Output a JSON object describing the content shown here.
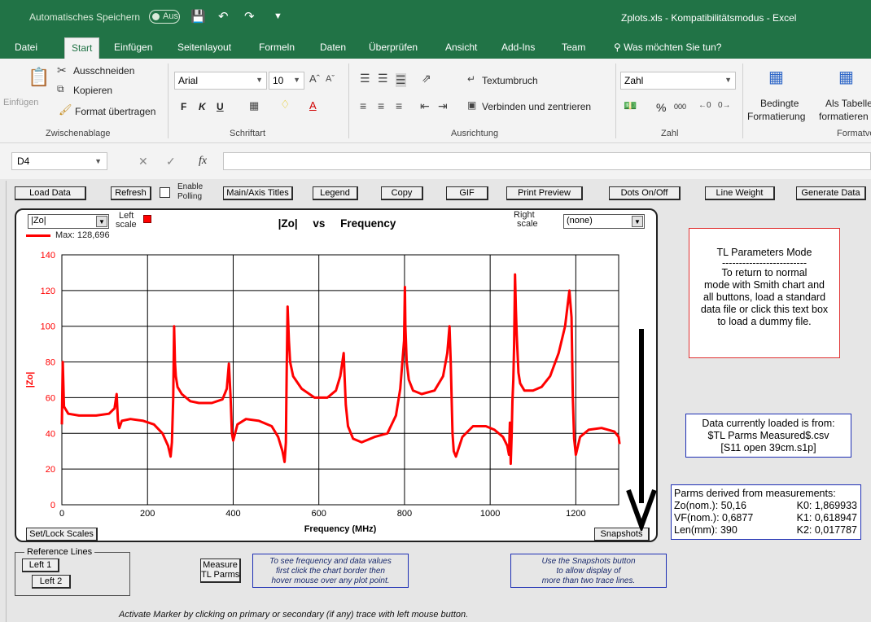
{
  "titlebar": {
    "autosave_label": "Automatisches Speichern",
    "autosave_state": "Aus",
    "window_title": "Zplots.xls  -  Kompatibilitätsmodus  -  Excel"
  },
  "tabs": [
    "Datei",
    "Start",
    "Einfügen",
    "Seitenlayout",
    "Formeln",
    "Daten",
    "Überprüfen",
    "Ansicht",
    "Add-Ins",
    "Team"
  ],
  "search_placeholder": "Was möchten Sie tun?",
  "ribbon": {
    "clipboard": {
      "paste": "Einfügen",
      "cut": "Ausschneiden",
      "copy": "Kopieren",
      "format_painter": "Format übertragen",
      "group": "Zwischenablage"
    },
    "font": {
      "font_name": "Arial",
      "font_size": "10",
      "bold": "F",
      "italic": "K",
      "underline": "U",
      "group": "Schriftart"
    },
    "alignment": {
      "wrap": "Textumbruch",
      "merge": "Verbinden und zentrieren",
      "group": "Ausrichtung"
    },
    "number": {
      "format": "Zahl",
      "percent": "%",
      "thousands": "000",
      "group": "Zahl"
    },
    "styles": {
      "conditional_1": "Bedingte",
      "conditional_2": "Formatierung",
      "table_1": "Als Tabelle",
      "table_2": "formatieren",
      "group": "Formatvo"
    }
  },
  "formula_bar": {
    "cell_ref": "D4",
    "fx": "fx",
    "value": ""
  },
  "toolbar_buttons": {
    "load_data": "Load Data",
    "refresh": "Refresh",
    "enable_polling_1": "Enable",
    "enable_polling_2": "Polling",
    "titles": "Main/Axis Titles",
    "legend": "Legend",
    "copy": "Copy",
    "gif": "GIF",
    "print_preview": "Print Preview",
    "dots": "Dots On/Off",
    "line_weight": "Line Weight",
    "generate": "Generate Data"
  },
  "chart_panel": {
    "left_select": "|Zo|",
    "left_scale_1": "Left",
    "left_scale_2": "scale",
    "right_scale_1": "Right",
    "right_scale_2": "scale",
    "right_select": "(none)",
    "legend_text": "Max: 128,696",
    "set_lock": "Set/Lock Scales",
    "snapshots": "Snapshots"
  },
  "chart_data": {
    "type": "line",
    "title": "|Zo|     vs     Frequency",
    "xlabel": "Frequency (MHz)",
    "ylabel": "|Zo|",
    "xlim": [
      0,
      1300
    ],
    "ylim": [
      0,
      140
    ],
    "xticks": [
      0,
      200,
      400,
      600,
      800,
      1000,
      1200
    ],
    "yticks": [
      0,
      20,
      40,
      60,
      80,
      100,
      120,
      140
    ],
    "grid": true,
    "series": [
      {
        "color": "#ff0000",
        "x": [
          0,
          2,
          5,
          15,
          40,
          80,
          110,
          123,
          128,
          131,
          134,
          140,
          160,
          190,
          215,
          235,
          248,
          254,
          257,
          260,
          262,
          264,
          266,
          270,
          280,
          300,
          320,
          350,
          375,
          385,
          390,
          394,
          397,
          400,
          410,
          430,
          460,
          490,
          505,
          515,
          520,
          523,
          525,
          527,
          530,
          533,
          540,
          560,
          590,
          620,
          640,
          650,
          655,
          658,
          660,
          663,
          668,
          680,
          700,
          730,
          760,
          780,
          790,
          795,
          799,
          801,
          802,
          805,
          810,
          820,
          840,
          870,
          890,
          900,
          905,
          908,
          912,
          915,
          920,
          935,
          960,
          990,
          1010,
          1030,
          1040,
          1044,
          1046,
          1048,
          1050,
          1052,
          1054,
          1056,
          1058,
          1060,
          1062,
          1064,
          1066,
          1070,
          1080,
          1100,
          1120,
          1140,
          1160,
          1175,
          1185,
          1190,
          1193,
          1196,
          1200,
          1210,
          1230,
          1260,
          1290,
          1300,
          1302
        ],
        "values": [
          45,
          80,
          55,
          51,
          50,
          50,
          51,
          54,
          62,
          47,
          43,
          47,
          48,
          47,
          45,
          40,
          33,
          27,
          35,
          60,
          100,
          80,
          72,
          66,
          62,
          58,
          57,
          57,
          59,
          65,
          79,
          60,
          40,
          36,
          45,
          48,
          47,
          44,
          38,
          30,
          24,
          35,
          75,
          111,
          92,
          80,
          72,
          65,
          60,
          60,
          64,
          72,
          80,
          85,
          72,
          56,
          44,
          37,
          35,
          38,
          40,
          50,
          65,
          80,
          92,
          122,
          100,
          80,
          70,
          64,
          62,
          64,
          72,
          85,
          100,
          80,
          40,
          30,
          27,
          38,
          44,
          44,
          42,
          38,
          33,
          28,
          46,
          23,
          38,
          58,
          70,
          90,
          129,
          110,
          95,
          85,
          74,
          68,
          64,
          64,
          66,
          72,
          85,
          100,
          120,
          105,
          60,
          37,
          28,
          38,
          42,
          43,
          41,
          38,
          34
        ]
      }
    ]
  },
  "tl_mode_box": {
    "title": "TL Parameters Mode",
    "dashes": "-------------------------",
    "line1": "To return to normal",
    "line2": "mode with Smith chart and",
    "line3": "all buttons, load a standard",
    "line4": "data file or click this text box",
    "line5": "to load a dummy file."
  },
  "data_loaded_box": {
    "line1": "Data currently loaded is from:",
    "line2": "$TL Parms Measured$.csv",
    "line3": "[S11 open   39cm.s1p]"
  },
  "parms_box": {
    "title": "Parms derived from measurements:",
    "rows": [
      {
        "left": "Zo(nom.): 50,16",
        "right": "K0: 1,869933"
      },
      {
        "left": "VF(nom.): 0,6877",
        "right": "K1: 0,618947"
      },
      {
        "left": "Len(mm): 390",
        "right": "K2: 0,017787"
      }
    ]
  },
  "reference_lines": {
    "label": "Reference Lines",
    "left1": "Left 1",
    "left2": "Left 2"
  },
  "measure_button": {
    "line1": "Measure",
    "line2": "TL Parms"
  },
  "info_hover": {
    "line1": "To see frequency and data values",
    "line2": "first click the chart border then",
    "line3": "hover mouse over any plot point."
  },
  "info_snapshots": {
    "line1": "Use the Snapshots button",
    "line2": "to allow display of",
    "line3": "more than two trace lines."
  },
  "footnote": "Activate Marker by clicking on primary or secondary (if any) trace with left mouse button."
}
